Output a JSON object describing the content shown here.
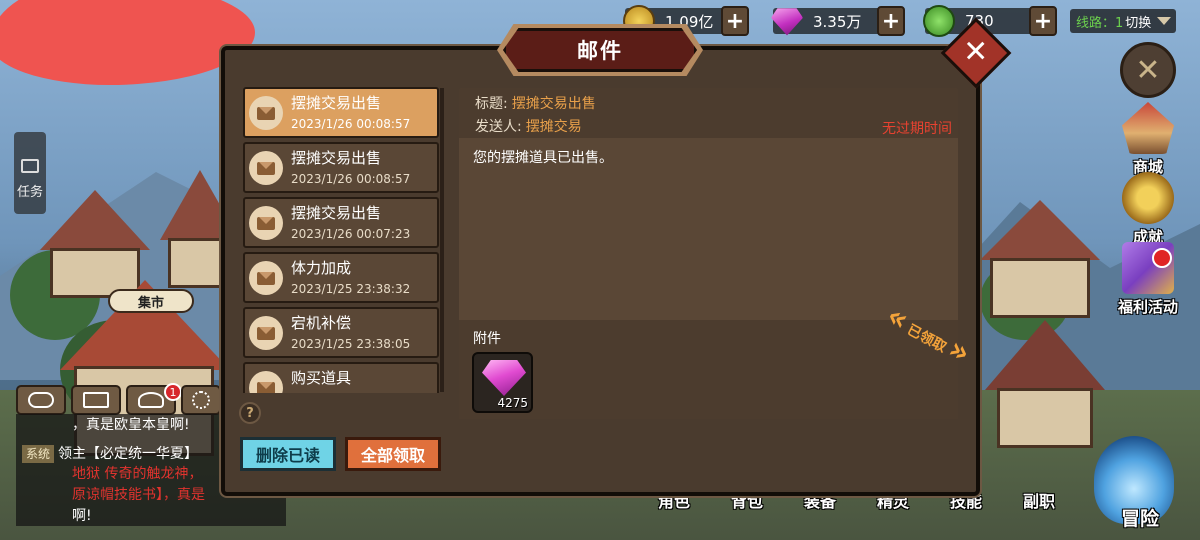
{
  "resources": {
    "gold": "1.09亿",
    "gems": "3.35万",
    "stamina": "730"
  },
  "server_line": {
    "label": "线路：1",
    "switch_label": "切换"
  },
  "left_ui": {
    "task_label": "任务",
    "market_sign": "集市",
    "friend_badge": "1"
  },
  "chat": {
    "line1": "，真是欧皇本皇啊!",
    "system_tag": "系统",
    "line2": "领主【必定统一华夏】",
    "line3": "地狱 传奇的触龙神，",
    "line4": "原谅帽技能书】，真是",
    "line5": "啊!"
  },
  "right_ui": {
    "shop": "商城",
    "achievement": "成就",
    "welfare": "福利活动"
  },
  "bottom_nav": [
    "角色",
    "背包",
    "装备",
    "精灵",
    "技能",
    "副职"
  ],
  "adventure_label": "冒险",
  "mail_dialog": {
    "title": "邮件",
    "close_glyph": "✕",
    "items": [
      {
        "title": "摆摊交易出售",
        "date": "2023/1/26 00:08:57",
        "selected": true
      },
      {
        "title": "摆摊交易出售",
        "date": "2023/1/26 00:08:57",
        "selected": false
      },
      {
        "title": "摆摊交易出售",
        "date": "2023/1/26 00:07:23",
        "selected": false
      },
      {
        "title": "体力加成",
        "date": "2023/1/25 23:38:32",
        "selected": false
      },
      {
        "title": "宕机补偿",
        "date": "2023/1/25 23:38:05",
        "selected": false
      },
      {
        "title": "购买道具",
        "date": "",
        "selected": false
      }
    ],
    "help_glyph": "?",
    "delete_read_label": "删除已读",
    "claim_all_label": "全部领取",
    "detail": {
      "subject_label": "标题:",
      "subject": "摆摊交易出售",
      "sender_label": "发送人:",
      "sender": "摆摊交易",
      "expiry": "无过期时间",
      "body": "您的摆摊道具已出售。",
      "attachment_label": "附件",
      "attachment_count": "4275",
      "claimed_stamp": "已领取"
    }
  }
}
